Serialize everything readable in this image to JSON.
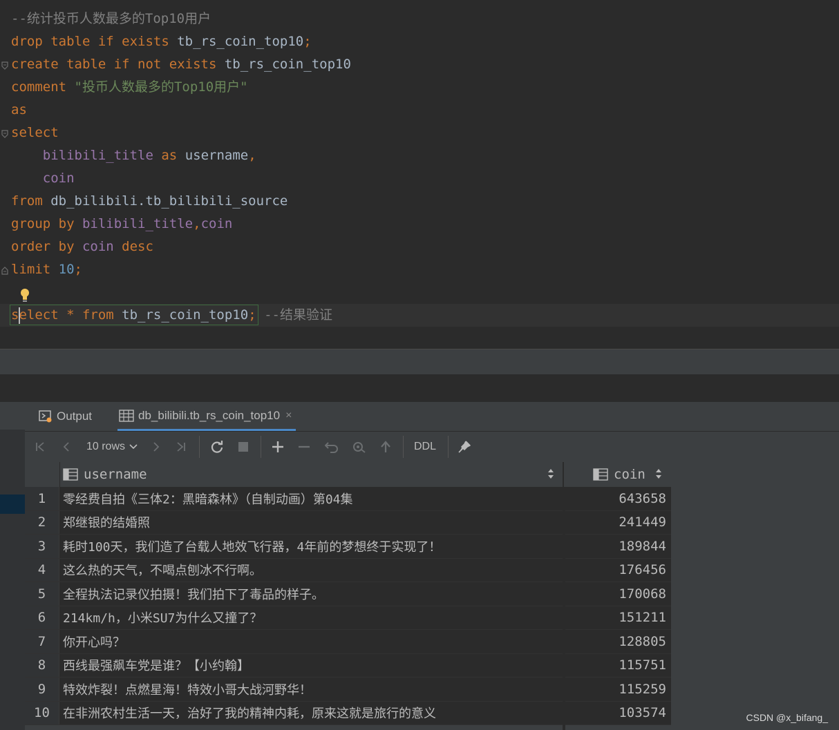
{
  "editor": {
    "lines": [
      {
        "tokens": [
          {
            "t": "--统计投币人数最多的Top10用户",
            "c": "cmt"
          }
        ]
      },
      {
        "tokens": [
          {
            "t": "drop table if exists ",
            "c": "kw"
          },
          {
            "t": "tb_rs_coin_top10",
            "c": "plain"
          },
          {
            "t": ";",
            "c": "kw"
          }
        ]
      },
      {
        "tokens": [
          {
            "t": "create table if not exists ",
            "c": "kw"
          },
          {
            "t": "tb_rs_coin_top10",
            "c": "plain"
          }
        ]
      },
      {
        "tokens": [
          {
            "t": "comment ",
            "c": "kw"
          },
          {
            "t": "\"投币人数最多的Top10用户\"",
            "c": "str"
          }
        ]
      },
      {
        "tokens": [
          {
            "t": "as",
            "c": "kw"
          }
        ]
      },
      {
        "tokens": [
          {
            "t": "select",
            "c": "kw"
          }
        ]
      },
      {
        "tokens": [
          {
            "t": "    ",
            "c": "plain"
          },
          {
            "t": "bilibili_title",
            "c": "fld"
          },
          {
            "t": " as ",
            "c": "kw"
          },
          {
            "t": "username",
            "c": "plain"
          },
          {
            "t": ",",
            "c": "kw"
          }
        ]
      },
      {
        "tokens": [
          {
            "t": "    ",
            "c": "plain"
          },
          {
            "t": "coin",
            "c": "fld"
          }
        ]
      },
      {
        "tokens": [
          {
            "t": "from ",
            "c": "kw"
          },
          {
            "t": "db_bilibili.tb_bilibili_source",
            "c": "plain"
          }
        ]
      },
      {
        "tokens": [
          {
            "t": "group by ",
            "c": "kw"
          },
          {
            "t": "bilibili_title",
            "c": "fld"
          },
          {
            "t": ",",
            "c": "kw"
          },
          {
            "t": "coin",
            "c": "fld"
          }
        ]
      },
      {
        "tokens": [
          {
            "t": "order by ",
            "c": "kw"
          },
          {
            "t": "coin",
            "c": "fld"
          },
          {
            "t": " desc",
            "c": "kw"
          }
        ]
      },
      {
        "tokens": [
          {
            "t": "limit ",
            "c": "kw"
          },
          {
            "t": "10",
            "c": "num"
          },
          {
            "t": ";",
            "c": "kw"
          }
        ]
      },
      {
        "tokens": []
      },
      {
        "tokens": [
          {
            "t": "select * from ",
            "c": "kw"
          },
          {
            "t": "tb_rs_coin_top10",
            "c": "plain"
          },
          {
            "t": "; ",
            "c": "kw"
          },
          {
            "t": "--结果验证",
            "c": "cmt"
          }
        ]
      }
    ]
  },
  "tabs": {
    "output": "Output",
    "table": "db_bilibili.tb_rs_coin_top10",
    "close": "×"
  },
  "toolbar": {
    "rows_label": "10 rows",
    "ddl": "DDL"
  },
  "grid": {
    "columns": [
      "username",
      "coin"
    ],
    "rows": [
      {
        "n": "1",
        "username": "零经费自拍《三体2：黑暗森林》（自制动画）第04集",
        "coin": "643658"
      },
      {
        "n": "2",
        "username": "郑继银的结婚照",
        "coin": "241449"
      },
      {
        "n": "3",
        "username": "耗时100天，我们造了台载人地效飞行器，4年前的梦想终于实现了！",
        "coin": "189844"
      },
      {
        "n": "4",
        "username": "这么热的天气，不喝点刨冰不行啊。",
        "coin": "176456"
      },
      {
        "n": "5",
        "username": "全程执法记录仪拍摄！我们拍下了毒品的样子。",
        "coin": "170068"
      },
      {
        "n": "6",
        "username": "214km/h，小米SU7为什么又撞了？",
        "coin": "151211"
      },
      {
        "n": "7",
        "username": "你开心吗？",
        "coin": "128805"
      },
      {
        "n": "8",
        "username": "西线最强飙车党是谁？【小约翰】",
        "coin": "115751"
      },
      {
        "n": "9",
        "username": "特效炸裂！点燃星海！特效小哥大战河野华！",
        "coin": "115259"
      },
      {
        "n": "10",
        "username": "在非洲农村生活一天，治好了我的精神内耗，原来这就是旅行的意义",
        "coin": "103574"
      }
    ]
  },
  "watermark": "CSDN @x_bifang_"
}
